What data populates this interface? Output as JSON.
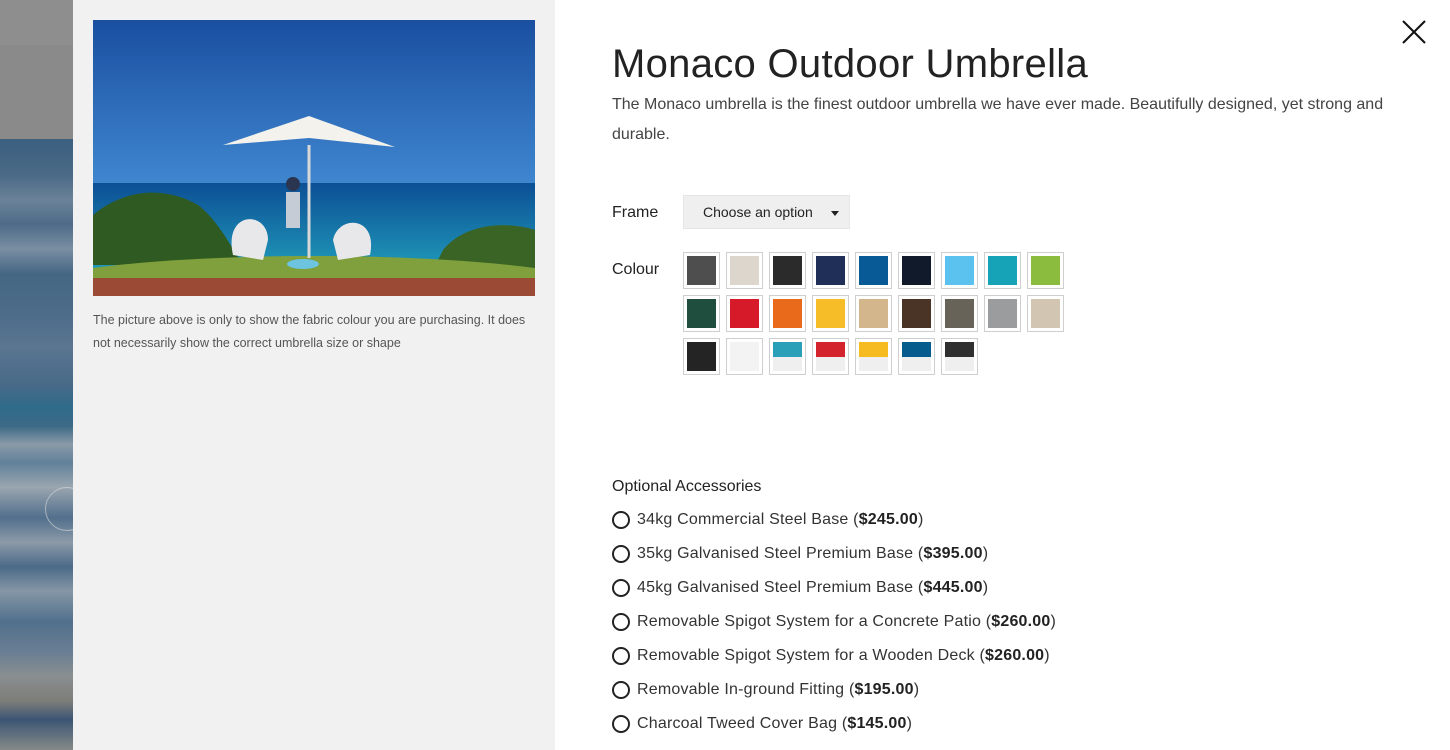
{
  "product": {
    "title": "Monaco Outdoor Umbrella",
    "description": "The Monaco umbrella is the finest outdoor umbrella we have ever made. Beautifully designed, yet strong and durable.",
    "image_caption": "The picture above is only to show the fabric colour you are purchasing. It does not necessarily show the correct umbrella size or shape"
  },
  "frame": {
    "label": "Frame",
    "selected": "Choose an option"
  },
  "colour": {
    "label": "Colour",
    "swatches": [
      {
        "color": "#4e4e4e",
        "split": false
      },
      {
        "color": "#ddd6cc",
        "split": false
      },
      {
        "color": "#2b2b2b",
        "split": false
      },
      {
        "color": "#1f2f57",
        "split": false
      },
      {
        "color": "#075a96",
        "split": false
      },
      {
        "color": "#111a2a",
        "split": false
      },
      {
        "color": "#5bc1ee",
        "split": false
      },
      {
        "color": "#17a3b7",
        "split": false
      },
      {
        "color": "#8cbc3d",
        "split": false
      },
      {
        "color": "#1f4e3f",
        "split": false
      },
      {
        "color": "#d71a29",
        "split": false
      },
      {
        "color": "#ea6a1c",
        "split": false
      },
      {
        "color": "#f6bd28",
        "split": false
      },
      {
        "color": "#d3b68c",
        "split": false
      },
      {
        "color": "#4a3426",
        "split": false
      },
      {
        "color": "#686359",
        "split": false
      },
      {
        "color": "#9a9c9e",
        "split": false
      },
      {
        "color": "#d2c6b2",
        "split": false
      },
      {
        "color": "#242424",
        "split": false
      },
      {
        "color": "#f3f3f3",
        "split": false
      },
      {
        "color": "#2aa0b8",
        "split": true
      },
      {
        "color": "#d3242e",
        "split": true
      },
      {
        "color": "#f5bb21",
        "split": true
      },
      {
        "color": "#075c8e",
        "split": true
      },
      {
        "color": "#2f2f2f",
        "split": true
      }
    ]
  },
  "accessories": {
    "title": "Optional Accessories",
    "items": [
      {
        "name": "34kg Commercial Steel Base",
        "price": "$245.00"
      },
      {
        "name": "35kg Galvanised Steel Premium Base",
        "price": "$395.00"
      },
      {
        "name": "45kg Galvanised Steel Premium Base",
        "price": "$445.00"
      },
      {
        "name": "Removable Spigot System for a Concrete Patio",
        "price": "$260.00"
      },
      {
        "name": "Removable Spigot System for a Wooden Deck",
        "price": "$260.00"
      },
      {
        "name": "Removable In-ground Fitting",
        "price": "$195.00"
      },
      {
        "name": "Charcoal Tweed Cover Bag",
        "price": "$145.00"
      }
    ]
  },
  "icons": {
    "close": "close-icon",
    "dropdown": "caret-down-icon",
    "gallery_prev": "chevron-left-icon"
  }
}
